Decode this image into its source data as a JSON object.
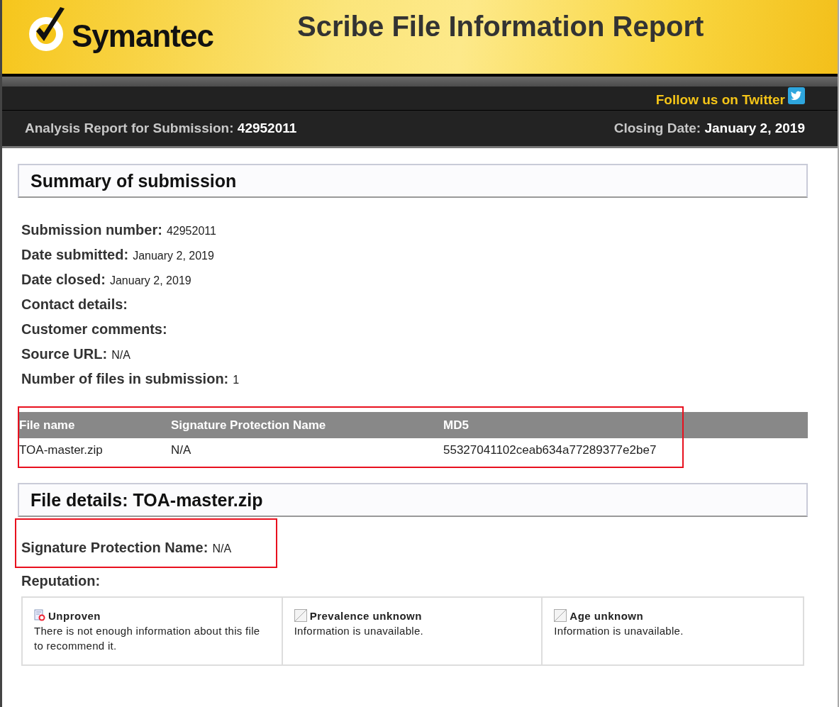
{
  "header": {
    "logo_text": "Symantec",
    "title": "Scribe File Information Report",
    "social_link": "Follow us on Twitter"
  },
  "report_bar": {
    "submission_label": "Analysis Report for Submission:",
    "submission_value": "42952011",
    "closing_label": "Closing Date:",
    "closing_value": "January 2, 2019"
  },
  "summary": {
    "heading": "Summary of submission",
    "fields": [
      {
        "label": "Submission number:",
        "value": "42952011"
      },
      {
        "label": "Date submitted:",
        "value": "January 2, 2019"
      },
      {
        "label": "Date closed:",
        "value": "January 2, 2019"
      },
      {
        "label": "Contact details:"
      },
      {
        "label": "Customer comments:"
      },
      {
        "label": "Source URL:",
        "value": "N/A"
      },
      {
        "label": "Number of files in submission:",
        "value": "1"
      }
    ]
  },
  "files_table": {
    "highlighted": true,
    "columns": [
      "File name",
      "Signature Protection Name",
      "MD5"
    ],
    "rows": [
      [
        "TOA-master.zip",
        "N/A",
        "55327041102ceab634a77289377e2be7"
      ]
    ]
  },
  "file_details": {
    "heading": "File details: TOA-master.zip",
    "signature": {
      "label": "Signature Protection Name:",
      "value": "N/A",
      "highlighted": true
    },
    "reputation_label": "Reputation:",
    "reputation": [
      {
        "kind": "unproven",
        "title": "Unproven",
        "text": "There is not enough information about this file to recommend it."
      },
      {
        "kind": "unknown",
        "title": "Prevalence unknown",
        "text": "Information is unavailable."
      },
      {
        "kind": "unknown",
        "title": "Age unknown",
        "text": "Information is unavailable."
      }
    ]
  }
}
